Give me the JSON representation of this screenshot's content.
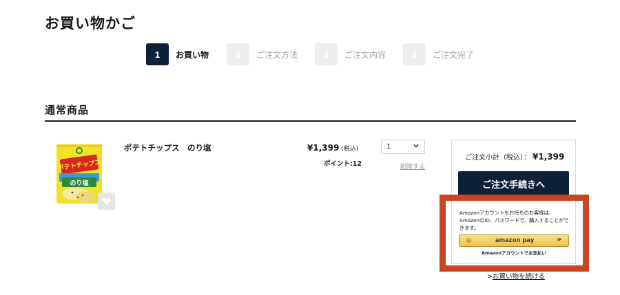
{
  "page": {
    "title": "お買い物かご"
  },
  "steps": [
    {
      "num": "1",
      "label": "お買い物",
      "active": true
    },
    {
      "num": "2",
      "label": "ご注文方法",
      "active": false
    },
    {
      "num": "3",
      "label": "ご注文内容",
      "active": false
    },
    {
      "num": "4",
      "label": "ご注文完了",
      "active": false
    }
  ],
  "section": {
    "title": "通常商品"
  },
  "cart_item": {
    "name": "ポテトチップス　のり塩",
    "price": "¥1,399",
    "tax_note": "(税込)",
    "points": "ポイント:12",
    "quantity": "1",
    "delete_label": "削除する",
    "image": {
      "brand_text": "ポテトチップス",
      "flavor_text": "のり塩",
      "colors": {
        "bag": "#f2e02b",
        "green": "#2f8a3e",
        "red": "#d6291f",
        "sky": "#3a9ad9"
      }
    }
  },
  "summary": {
    "subtotal_label": "ご注文小計（税込）：",
    "subtotal_value": "¥1,399",
    "checkout_label": "ご注文手続きへ"
  },
  "amazon": {
    "description": "Amazonアカウントをお持ちのお客様は、AmazonのID、パスワードで、購入することができます。",
    "badge": "$",
    "button_logo": "amazon pay",
    "button_arrow": "»",
    "caption": "Amazonアカウントでお支払い"
  },
  "continue": {
    "prefix": ">",
    "label": "お買い物を続ける"
  },
  "colors": {
    "navy": "#0f2137",
    "highlight": "#c94420",
    "step_inactive": "#eeeeee"
  },
  "icons": {
    "favorite": "heart-icon",
    "dropdown": "chevron-down-icon"
  }
}
